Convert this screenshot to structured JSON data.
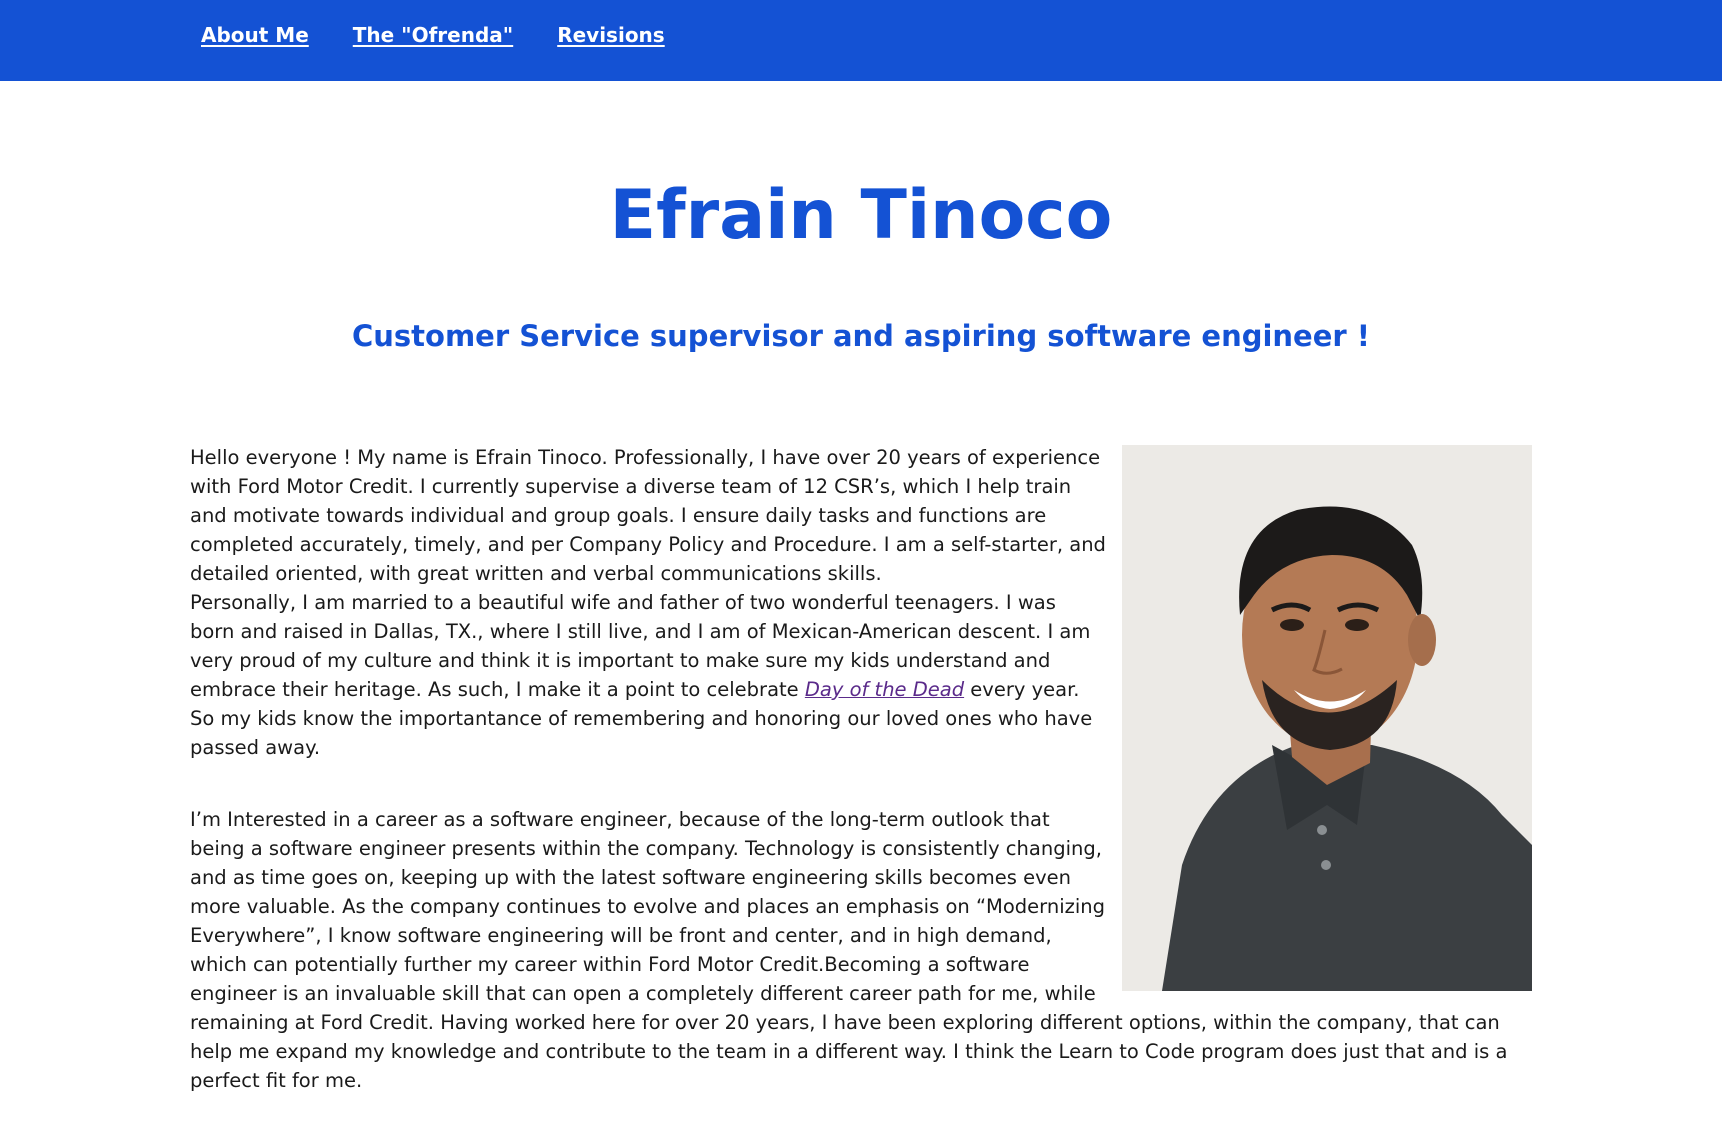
{
  "nav": {
    "items": [
      {
        "label": "About Me"
      },
      {
        "label": "The \"Ofrenda\""
      },
      {
        "label": "Revisions"
      }
    ]
  },
  "header": {
    "title": "Efrain Tinoco",
    "subtitle": "Customer Service supervisor and aspiring software engineer !"
  },
  "bio": {
    "para1": "Hello everyone ! My name is Efrain Tinoco. Professionally, I have over 20 years of experience with Ford Motor Credit. I currently supervise a diverse team of 12 CSR’s, which I help train and motivate towards individual and group goals. I ensure daily tasks and functions are completed accurately, timely, and per Company Policy and Procedure. I am a self-starter, and detailed oriented, with great written and verbal communications skills.",
    "para2_before": "Personally, I am married to a beautiful wife and father of two wonderful teenagers. I was born and raised in Dallas, TX., where I still live, and I am of Mexican-American descent. I am very proud of my culture and think it is important to make sure my kids understand and embrace their heritage. As such, I make it a point to celebrate ",
    "para2_link": "Day of the Dead",
    "para2_after": " every year. So my kids know the importantance of remembering and honoring our loved ones who have passed away.",
    "para3": "I’m Interested in a career as a software engineer, because of the long-term outlook that being a software engineer presents within the company. Technology is consistently changing, and as time goes on, keeping up with the latest software engineering skills becomes even more valuable. As the company continues to evolve and places an emphasis on “Modernizing Everywhere”, I know software engineering will be front and center, and in high demand, which can potentially further my career within Ford Motor Credit.Becoming a software engineer is an invaluable skill that can open a completely different career path for me, while remaining at Ford Credit. Having worked here for over 20 years, I have been exploring different options, within the company, that can help me expand my knowledge and contribute to the team in a different way. I think the Learn to Code program does just that and is a perfect fit for me."
  },
  "colors": {
    "brand": "#1452d4",
    "text": "#1a1a1a",
    "visited_link": "#5a2a8a"
  }
}
